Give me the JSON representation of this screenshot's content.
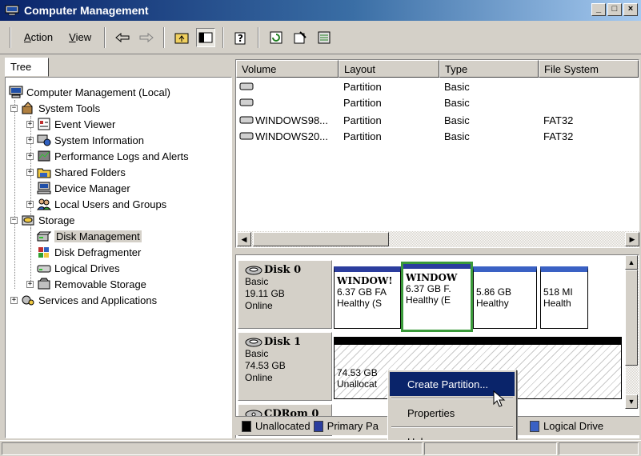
{
  "window": {
    "title": "Computer Management",
    "buttons": [
      "_",
      "□",
      "×"
    ]
  },
  "menu": {
    "action": "Action",
    "action_ul": "A",
    "view": "View",
    "view_ul": "V"
  },
  "tree": {
    "header": "Tree",
    "items": [
      {
        "label": "Computer Management (Local)",
        "icon": "computer-icon"
      },
      {
        "label": "System Tools",
        "icon": "tools-icon"
      },
      {
        "label": "Event Viewer",
        "icon": "event-viewer-icon"
      },
      {
        "label": "System Information",
        "icon": "system-info-icon"
      },
      {
        "label": "Performance Logs and Alerts",
        "icon": "performance-icon"
      },
      {
        "label": "Shared Folders",
        "icon": "folder-icon"
      },
      {
        "label": "Device Manager",
        "icon": "device-manager-icon"
      },
      {
        "label": "Local Users and Groups",
        "icon": "users-icon"
      },
      {
        "label": "Storage",
        "icon": "storage-icon"
      },
      {
        "label": "Disk Management",
        "icon": "disk-management-icon",
        "selected": true
      },
      {
        "label": "Disk Defragmenter",
        "icon": "defrag-icon"
      },
      {
        "label": "Logical Drives",
        "icon": "drive-icon"
      },
      {
        "label": "Removable Storage",
        "icon": "removable-storage-icon"
      },
      {
        "label": "Services and Applications",
        "icon": "services-icon"
      }
    ]
  },
  "volumes": {
    "columns": [
      "Volume",
      "Layout",
      "Type",
      "File System"
    ],
    "rows": [
      {
        "volume": "",
        "layout": "Partition",
        "type": "Basic",
        "fs": ""
      },
      {
        "volume": "",
        "layout": "Partition",
        "type": "Basic",
        "fs": ""
      },
      {
        "volume": "WINDOWS98...",
        "layout": "Partition",
        "type": "Basic",
        "fs": "FAT32"
      },
      {
        "volume": "WINDOWS20...",
        "layout": "Partition",
        "type": "Basic",
        "fs": "FAT32"
      }
    ]
  },
  "disks": [
    {
      "name": "Disk 0",
      "type": "Basic",
      "size": "19.11 GB",
      "status": "Online",
      "partitions": [
        {
          "name": "WINDOW!",
          "detail": "6.37 GB FA",
          "status": "Healthy (S"
        },
        {
          "name": "WINDOW",
          "detail": "6.37 GB F.",
          "status": "Healthy (E"
        },
        {
          "name": "",
          "detail": "5.86 GB",
          "status": "Healthy"
        },
        {
          "name": "",
          "detail": "518 MI",
          "status": "Health"
        }
      ]
    },
    {
      "name": "Disk 1",
      "type": "Basic",
      "size": "74.53 GB",
      "status": "Online",
      "unallocated": {
        "detail": "74.53 GB",
        "status": "Unallocat"
      }
    },
    {
      "name": "CDRom 0"
    }
  ],
  "legend": {
    "items": [
      {
        "label": "Unallocated",
        "color": "#000000"
      },
      {
        "label": "Primary Pa",
        "color": "#2b3d9e"
      },
      {
        "label": "Logical Drive",
        "color": "#3a61c4"
      }
    ]
  },
  "context_menu": {
    "items": [
      "Create Partition...",
      "Properties",
      "Help"
    ]
  },
  "colors": {
    "selection": "#0a246a",
    "primary_partition": "#2b3d9e",
    "logical_drive": "#3a61c4",
    "selected_outline": "#3a9a3a"
  }
}
